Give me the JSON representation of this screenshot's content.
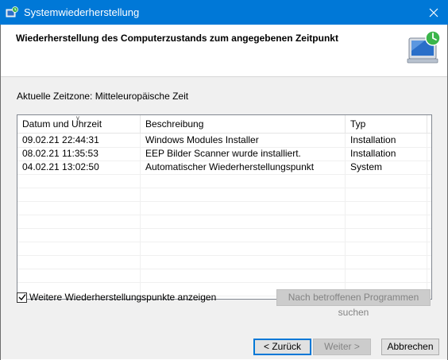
{
  "window": {
    "title": "Systemwiederherstellung"
  },
  "header": {
    "title": "Wiederherstellung des Computerzustands zum angegebenen Zeitpunkt"
  },
  "timezone_label": "Aktuelle Zeitzone: Mitteleuropäische Zeit",
  "table": {
    "columns": [
      "Datum und Uhrzeit",
      "Beschreibung",
      "Typ"
    ],
    "sort_column": "Datum und Uhrzeit",
    "rows": [
      {
        "date": "09.02.21 22:44:31",
        "description": "Windows Modules Installer",
        "type": "Installation"
      },
      {
        "date": "08.02.21 11:35:53",
        "description": "EEP Bilder Scanner wurde installiert.",
        "type": "Installation"
      },
      {
        "date": "04.02.21 13:02:50",
        "description": "Automatischer Wiederherstellungspunkt",
        "type": "System"
      }
    ]
  },
  "more_points": {
    "label": "Weitere Wiederherstellungspunkte anzeigen",
    "checked": true
  },
  "buttons": {
    "scan": "Nach betroffenen Programmen suchen",
    "back": "< Zurück",
    "next": "Weiter >",
    "cancel": "Abbrechen"
  },
  "colors": {
    "titlebar": "#0078d7",
    "selected_border": "#0078d7"
  },
  "icons": {
    "app": "system-restore-icon",
    "header": "monitor-restore-icon",
    "close": "close-icon",
    "check": "check-icon"
  }
}
